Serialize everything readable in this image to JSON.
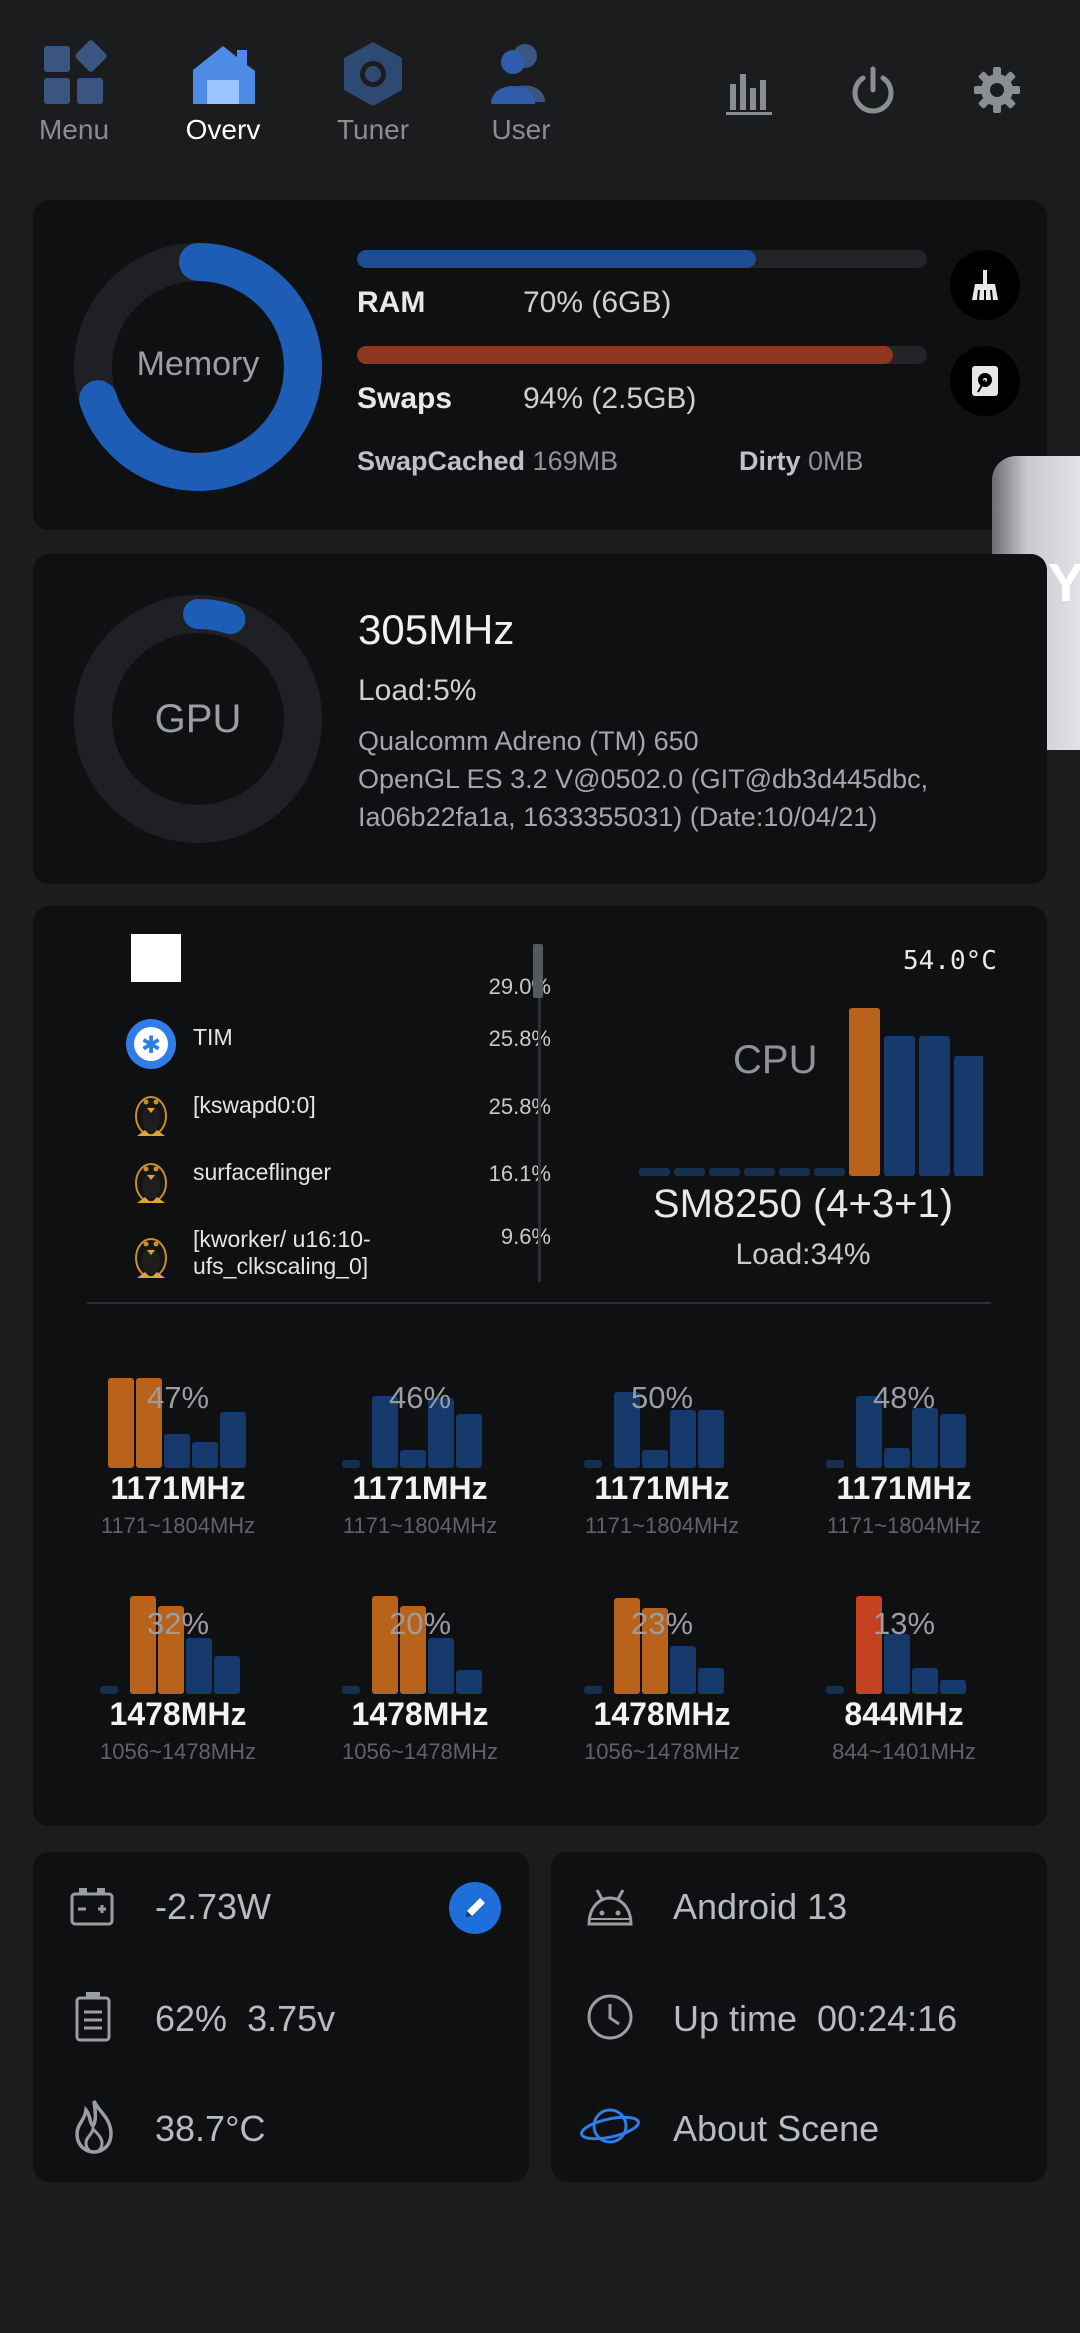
{
  "nav": {
    "items": [
      {
        "label": "Menu",
        "active": false
      },
      {
        "label": "Overv",
        "active": true
      },
      {
        "label": "Tuner",
        "active": false
      },
      {
        "label": "User",
        "active": false
      }
    ]
  },
  "memory": {
    "ring_label": "Memory",
    "ram_label": "RAM",
    "ram_value": "70% (6GB)",
    "ram_fraction": 0.7,
    "swaps_label": "Swaps",
    "swaps_value": "94% (2.5GB)",
    "swaps_fraction": 0.94,
    "swapcached_label": "SwapCached",
    "swapcached_value": "169MB",
    "dirty_label": "Dirty",
    "dirty_value": "0MB"
  },
  "gpu": {
    "ring_label": "GPU",
    "freq": "305MHz",
    "load": "Load:5%",
    "load_fraction": 0.05,
    "info_line1": "Qualcomm Adreno (TM) 650",
    "info_line2": "OpenGL ES 3.2 V@0502.0 (GIT@db3d445dbc,",
    "info_line3": "Ia06b22fa1a, 1633355031) (Date:10/04/21)"
  },
  "cpu": {
    "temp": "54.0°C",
    "label": "CPU",
    "chip": "SM8250 (4+3+1)",
    "load": "Load:34%",
    "processes": [
      {
        "name": "",
        "pct": "29.0%",
        "icon": "blank-app-icon"
      },
      {
        "name": "TIM",
        "pct": "25.8%",
        "icon": "tim-app-icon"
      },
      {
        "name": "[kswapd0:0]",
        "pct": "25.8%",
        "icon": "linux-penguin-icon"
      },
      {
        "name": "surfaceflinger",
        "pct": "16.1%",
        "icon": "linux-penguin-icon"
      },
      {
        "name": "[kworker/ u16:10-ufs_clkscaling_0]",
        "pct": "9.6%",
        "icon": "linux-penguin-icon"
      }
    ],
    "cores": [
      {
        "pct": "47%",
        "freq": "1171MHz",
        "range": "1171~1804MHz"
      },
      {
        "pct": "46%",
        "freq": "1171MHz",
        "range": "1171~1804MHz"
      },
      {
        "pct": "50%",
        "freq": "1171MHz",
        "range": "1171~1804MHz"
      },
      {
        "pct": "48%",
        "freq": "1171MHz",
        "range": "1171~1804MHz"
      },
      {
        "pct": "32%",
        "freq": "1478MHz",
        "range": "1056~1478MHz"
      },
      {
        "pct": "20%",
        "freq": "1478MHz",
        "range": "1056~1478MHz"
      },
      {
        "pct": "23%",
        "freq": "1478MHz",
        "range": "1056~1478MHz"
      },
      {
        "pct": "13%",
        "freq": "844MHz",
        "range": "844~1401MHz"
      }
    ]
  },
  "battery": {
    "power": "-2.73W",
    "level": "62%",
    "voltage": "3.75v",
    "temp": "38.7°C"
  },
  "system": {
    "android": "Android 13",
    "uptime_label": "Up time",
    "uptime_value": "00:24:16",
    "about": "About Scene"
  },
  "colors": {
    "blue": "#1e5db5",
    "orange": "#b8621c",
    "red": "#c4421f"
  }
}
